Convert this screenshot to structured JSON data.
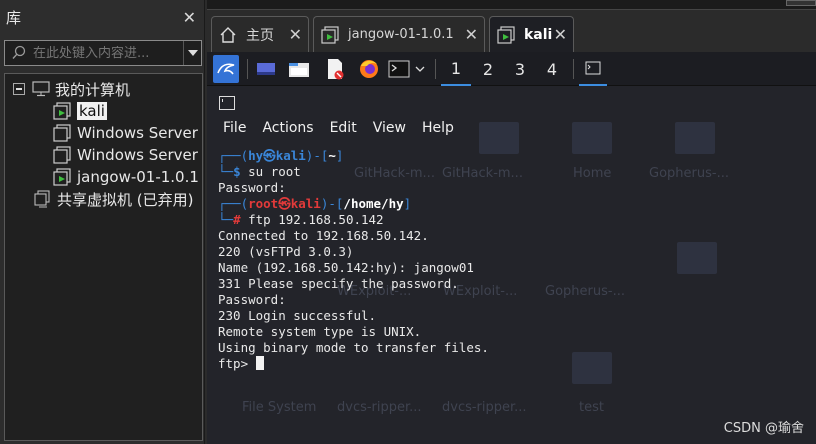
{
  "library": {
    "title": "库",
    "search_placeholder": "在此处键入内容进...",
    "tree": {
      "root_label": "我的计算机",
      "vms": [
        "kali",
        "Windows Server",
        "Windows Server",
        "jangow-01-1.0.1"
      ],
      "shared_label": "共享虚拟机 (已弃用)"
    }
  },
  "tabs": [
    {
      "label": "主页"
    },
    {
      "label": "jangow-01-1.0.1"
    },
    {
      "label": "kali"
    }
  ],
  "workspaces": [
    "1",
    "2",
    "3",
    "4"
  ],
  "desktop_labels": [
    "GitHack-m...",
    "GitHack-m...",
    "Home",
    "Gopherus-...",
    "WExploit-...",
    "WExploit-...",
    "Gopherus-...",
    "File System",
    "dvcs-ripper...",
    "dvcs-ripper...",
    "test"
  ],
  "terminal": {
    "menu": [
      "File",
      "Actions",
      "Edit",
      "View",
      "Help"
    ],
    "prompt1": {
      "corner_top": "┌──(",
      "user": "hy",
      "at": "㉿",
      "host": "kali",
      "close": ")-[",
      "path": "~",
      "end": "]",
      "corner_bot": "└─",
      "sym": "$",
      "cmd": " su root"
    },
    "password1": "Password:",
    "prompt2": {
      "corner_top": "┌──(",
      "user": "root",
      "at": "㉿",
      "host": "kali",
      "close": ")-[",
      "path": "/home/hy",
      "end": "]",
      "corner_bot": "└─",
      "sym": "#",
      "cmd": " ftp 192.168.50.142"
    },
    "output": [
      "Connected to 192.168.50.142.",
      "220 (vsFTPd 3.0.3)",
      "Name (192.168.50.142:hy): jangow01",
      "331 Please specify the password.",
      "Password:",
      "230 Login successful.",
      "Remote system type is UNIX.",
      "Using binary mode to transfer files."
    ],
    "ftp_prompt": "ftp> "
  },
  "watermark": "CSDN @瑜舍",
  "colors": {
    "accent": "#3a86d8",
    "root_red": "#e23a3a",
    "term_bg": "#23242a"
  }
}
